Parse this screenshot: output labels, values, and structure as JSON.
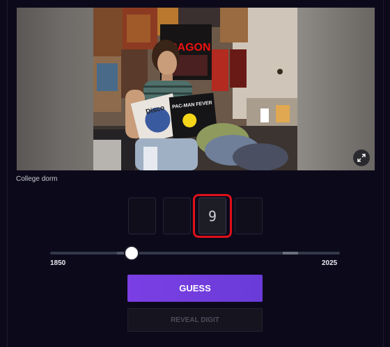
{
  "photo": {
    "caption": "College dorm",
    "poster_text": "DRAGON",
    "record_left_text": "Disco",
    "record_right_text": "PAC-MAN FEVER",
    "expand_icon": "expand-icon"
  },
  "digits": [
    "",
    "",
    "9",
    ""
  ],
  "slider": {
    "min_label": "1850",
    "max_label": "2025"
  },
  "buttons": {
    "guess_label": "GUESS",
    "reveal_label": "REVEAL DIGIT"
  },
  "colors": {
    "background": "#0c0a1a",
    "accent": "#7b3fe4",
    "highlight": "#e0101a"
  }
}
